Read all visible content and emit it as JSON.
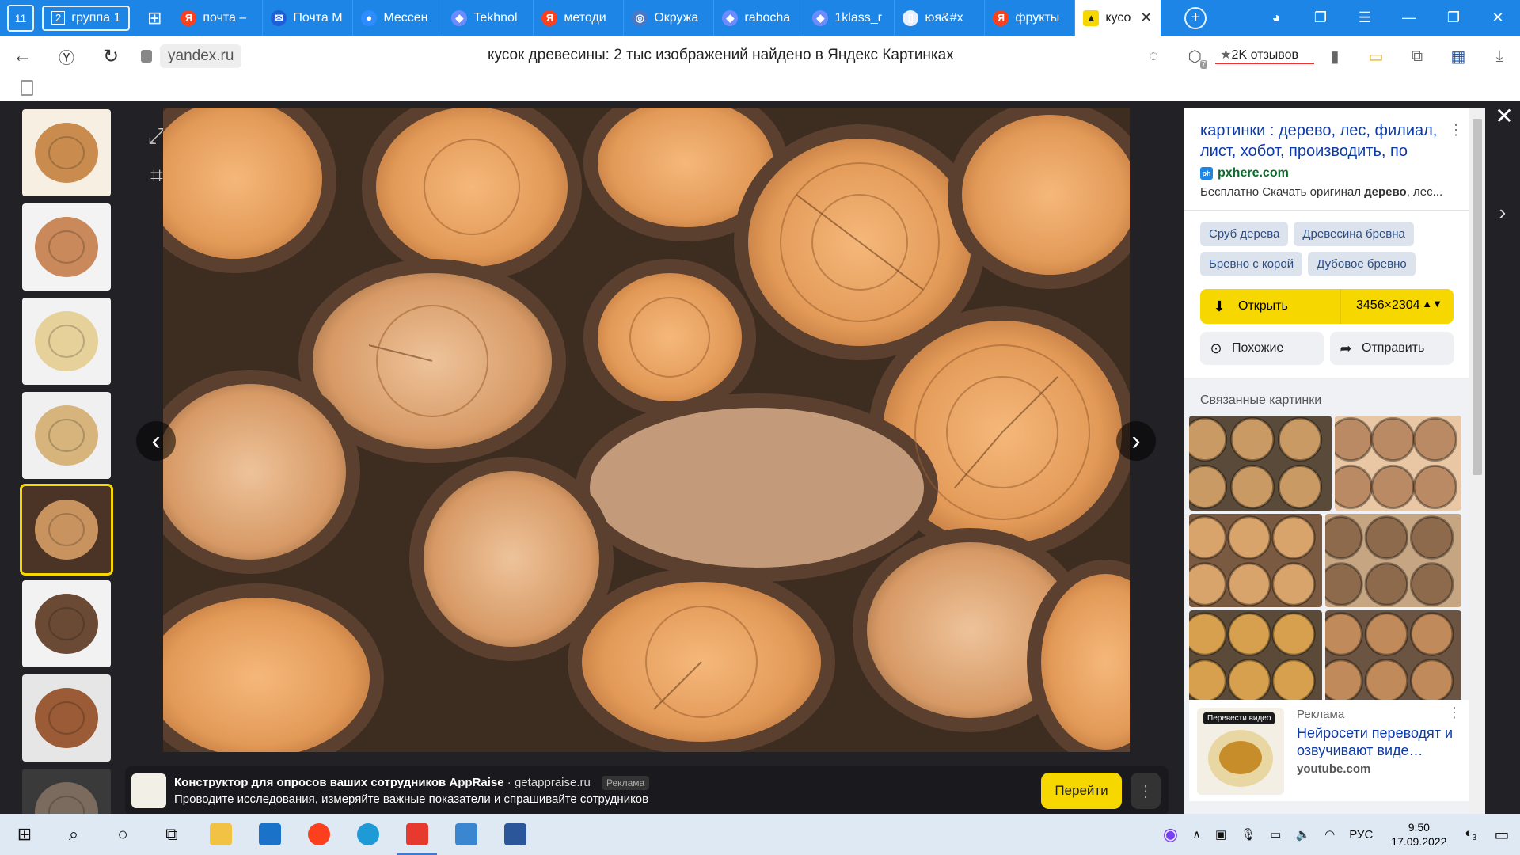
{
  "browser": {
    "counter_tab": "11",
    "group": {
      "number": "2",
      "label": "группа 1"
    },
    "tabs": [
      {
        "title": "почта –",
        "color": "#fc3f1d",
        "glyph": "Я"
      },
      {
        "title": "Почта М",
        "color": "#1e5fd6",
        "glyph": "✉"
      },
      {
        "title": "Мессен",
        "color": "#2d8cff",
        "glyph": "●"
      },
      {
        "title": "Tekhnol",
        "color": "#6b8cff",
        "glyph": "◆"
      },
      {
        "title": "методи",
        "color": "#fc3f1d",
        "glyph": "Я"
      },
      {
        "title": "Окружа",
        "color": "#4a78c5",
        "glyph": "◎"
      },
      {
        "title": "rabocha",
        "color": "#6b8cff",
        "glyph": "◆"
      },
      {
        "title": "1klass_r",
        "color": "#6b8cff",
        "glyph": "◆"
      },
      {
        "title": "юя&#x",
        "color": "#e8f0ff",
        "glyph": "▯"
      },
      {
        "title": "фрукты",
        "color": "#fc3f1d",
        "glyph": "Я"
      }
    ],
    "active_tab": {
      "title": "кусо",
      "glyph": "▲"
    },
    "url_host": "yandex.ru",
    "page_title": "кусок древесины: 2 тыс изображений найдено в Яндекс Картинках",
    "reviews": "2K отзывов",
    "ext_badge": "7"
  },
  "viewer": {
    "selected_thumb": 4,
    "thumb_count": 8,
    "ad": {
      "title": "Конструктор для опросов ваших сотрудников AppRaise",
      "domain": "getappraise.ru",
      "badge": "Реклама",
      "text": "Проводите исследования, измеряйте важные показатели и спрашивайте сотрудников",
      "button": "Перейти"
    }
  },
  "panel": {
    "source": {
      "title": "картинки : дерево, лес, филиал, лист, хобот, производить, по",
      "host": "pxhere.com",
      "desc_prefix": "Бесплатно Скачать оригинал ",
      "desc_bold": "дерево",
      "desc_suffix": ", лес..."
    },
    "tags": [
      "Сруб дерева",
      "Древесина бревна",
      "Бревно с корой",
      "Дубовое бревно"
    ],
    "open_label": "Открыть",
    "size": "3456×2304",
    "similar_label": "Похожие",
    "send_label": "Отправить",
    "related_title": "Связанные картинки",
    "ad": {
      "label": "Реклама",
      "headline": "Нейросети переводят и озвучивают виде…",
      "domain": "youtube.com",
      "thumb_caption": "Перевести видео"
    }
  },
  "taskbar": {
    "lang": "РУС",
    "time": "9:50",
    "date": "17.09.2022",
    "notif_count": "3"
  }
}
